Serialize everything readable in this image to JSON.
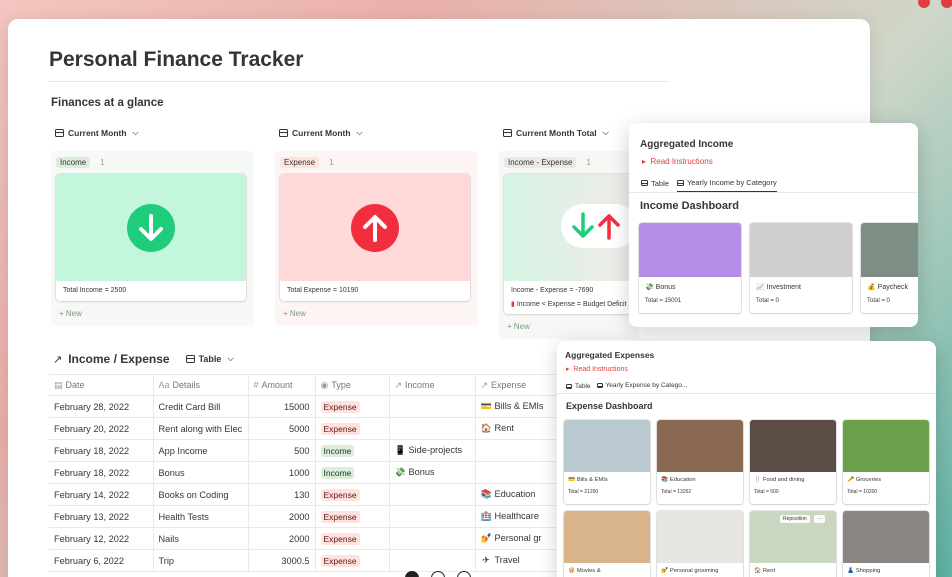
{
  "page": {
    "title": "Personal Finance Tracker",
    "section_glance": "Finances at a glance"
  },
  "boards": [
    {
      "view": "Current Month",
      "tag": "Income",
      "count": "1",
      "card_text": "Total Income = 2500",
      "new": "New",
      "tag_color": "#dbeddb",
      "cover_color": "#c4f5dd",
      "circle_color": "#1fcc7c",
      "arrow": "down"
    },
    {
      "view": "Current Month",
      "tag": "Expense",
      "count": "1",
      "card_text": "Total Expense = 10190",
      "new": "New",
      "tag_color": "#ffe2dd",
      "cover_color": "#ffd9d9",
      "circle_color": "#f02e3e",
      "arrow": "up"
    },
    {
      "view": "Current Month Total",
      "tag": "Income - Expense",
      "count": "1",
      "card_text": "Income - Expense = -7690",
      "card_text2": "Income < Expense = Budget Deficit",
      "new": "New",
      "tag_color": "#e9e9e7",
      "cover_color": "#d6f5e6",
      "arrow": "both"
    }
  ],
  "income_expense": {
    "title": "Income / Expense",
    "view": "Table",
    "columns": [
      "Date",
      "Details",
      "Amount",
      "Type",
      "Income",
      "Expense"
    ],
    "rows": [
      {
        "date": "February 28, 2022",
        "details": "Credit Card Bill",
        "amount": "15000",
        "type": "Expense",
        "income": "",
        "income_icon": "",
        "expense": "Bills & EMIs",
        "expense_icon": "💳"
      },
      {
        "date": "February 20, 2022",
        "details": "Rent along with Elec",
        "amount": "5000",
        "type": "Expense",
        "income": "",
        "income_icon": "",
        "expense": "Rent",
        "expense_icon": "🏠"
      },
      {
        "date": "February 18, 2022",
        "details": "App Income",
        "amount": "500",
        "type": "Income",
        "income": "Side-projects",
        "income_icon": "📱",
        "expense": "",
        "expense_icon": ""
      },
      {
        "date": "February 18, 2022",
        "details": "Bonus",
        "amount": "1000",
        "type": "Income",
        "income": "Bonus",
        "income_icon": "💸",
        "expense": "",
        "expense_icon": ""
      },
      {
        "date": "February 14, 2022",
        "details": "Books on Coding",
        "amount": "130",
        "type": "Expense",
        "income": "",
        "income_icon": "",
        "expense": "Education",
        "expense_icon": "📚"
      },
      {
        "date": "February 13, 2022",
        "details": "Health Tests",
        "amount": "2000",
        "type": "Expense",
        "income": "",
        "income_icon": "",
        "expense": "Healthcare",
        "expense_icon": "🏥"
      },
      {
        "date": "February 12, 2022",
        "details": "Nails",
        "amount": "2000",
        "type": "Expense",
        "income": "",
        "income_icon": "",
        "expense": "Personal gr",
        "expense_icon": "💅"
      },
      {
        "date": "February 6, 2022",
        "details": "Trip",
        "amount": "3000.5",
        "type": "Expense",
        "income": "",
        "income_icon": "",
        "expense": "Travel",
        "expense_icon": "✈"
      }
    ]
  },
  "aggregated_income": {
    "title": "Aggregated Income",
    "read": "Read Instructions",
    "tabs": [
      "Table",
      "Yearly Income by Category"
    ],
    "dashboard": "Income Dashboard",
    "cards": [
      {
        "icon": "💸",
        "name": "Bonus",
        "total": "Total = 15001",
        "cover": "#b38ee8"
      },
      {
        "icon": "📈",
        "name": "Investment",
        "total": "Total = 0",
        "cover": "#cfcfcf"
      },
      {
        "icon": "💰",
        "name": "Paycheck",
        "total": "Total = 0",
        "cover": "#7d8f84"
      }
    ]
  },
  "aggregated_expenses": {
    "title": "Aggregated Expenses",
    "read": "Read Instructions",
    "tabs": [
      "Table",
      "Yearly Expense by Catego..."
    ],
    "dashboard": "Expense Dashboard",
    "reposition": "Reposition",
    "more": "···",
    "cards": [
      {
        "icon": "💳",
        "name": "Bills & EMIs",
        "total": "Total = 21200",
        "cover": "#b9c9cf"
      },
      {
        "icon": "📚",
        "name": "Education",
        "total": "Total = 13262",
        "cover": "#8a6a52"
      },
      {
        "icon": "🍴",
        "name": "Food and dining",
        "total": "Total = 500",
        "cover": "#5b4c45"
      },
      {
        "icon": "🥕",
        "name": "Groceries",
        "total": "Total = 10200",
        "cover": "#6aa04a"
      },
      {
        "icon": "🍿",
        "name": "Movies &",
        "total": "",
        "cover": "#d9b48a"
      },
      {
        "icon": "💅",
        "name": "Personal grooming",
        "total": "",
        "cover": "#e8e6e2"
      },
      {
        "icon": "🏠",
        "name": "Rent",
        "total": "",
        "cover": "#c9d6c0"
      },
      {
        "icon": "👗",
        "name": "Shopping",
        "total": "",
        "cover": "#8a8580"
      }
    ]
  }
}
